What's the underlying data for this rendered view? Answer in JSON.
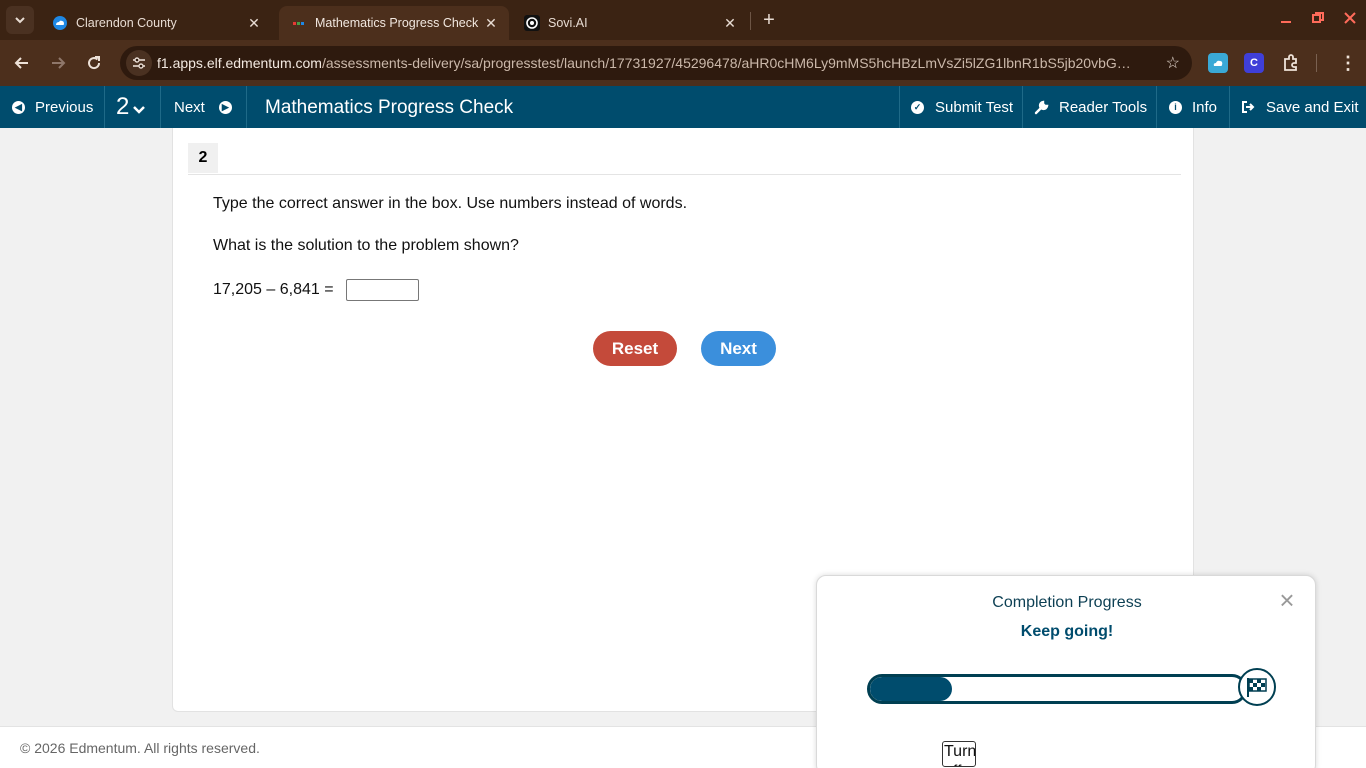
{
  "browser": {
    "tabs": [
      {
        "title": "Clarendon County",
        "active": false,
        "favicon": "cloud-icon"
      },
      {
        "title": "Mathematics Progress Check",
        "active": true,
        "favicon": "edmentum-icon"
      },
      {
        "title": "Sovi.AI",
        "active": false,
        "favicon": "sovi-icon"
      }
    ],
    "url_host": "f1.apps.elf.edmentum.com",
    "url_path": "/assessments-delivery/sa/progresstest/launch/17731927/45296478/aHR0cHM6Ly9mMS5hcHBzLmVsZi5lZG1lbnR1bS5jb20vbG…",
    "extensions": [
      "cloud-extension-icon",
      "c-extension-icon",
      "puzzle-icon"
    ],
    "ext_c_letter": "C"
  },
  "appbar": {
    "previous_label": "Previous",
    "question_number": "2",
    "next_label": "Next",
    "title": "Mathematics Progress Check",
    "submit_label": "Submit Test",
    "reader_tools_label": "Reader Tools",
    "info_label": "Info",
    "save_exit_label": "Save and Exit",
    "color": "#004c6d"
  },
  "question": {
    "number": "2",
    "instruction": "Type the correct answer in the box. Use numbers instead of words.",
    "prompt": "What is the solution to the problem shown?",
    "equation": "17,205 – 6,841 =",
    "answer_value": "",
    "reset_label": "Reset",
    "next_label": "Next",
    "reset_color": "#c44a3a",
    "next_color": "#3b8fdc"
  },
  "footer": {
    "copyright": "© 2026 Edmentum. All rights reserved."
  },
  "progress": {
    "title": "Completion Progress",
    "message": "Keep going!",
    "fraction": 0.22,
    "turn_off_label": "Turn off"
  }
}
